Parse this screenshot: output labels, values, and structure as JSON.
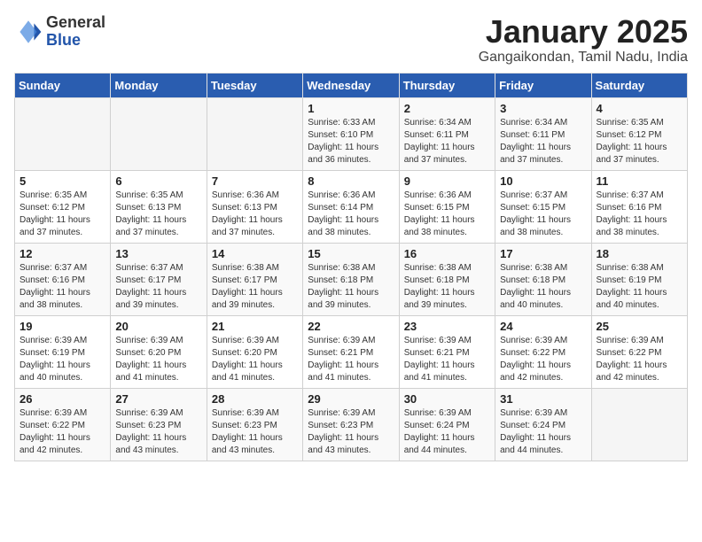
{
  "header": {
    "logo_general": "General",
    "logo_blue": "Blue",
    "month_title": "January 2025",
    "subtitle": "Gangaikondan, Tamil Nadu, India"
  },
  "weekdays": [
    "Sunday",
    "Monday",
    "Tuesday",
    "Wednesday",
    "Thursday",
    "Friday",
    "Saturday"
  ],
  "weeks": [
    [
      {
        "day": "",
        "info": ""
      },
      {
        "day": "",
        "info": ""
      },
      {
        "day": "",
        "info": ""
      },
      {
        "day": "1",
        "info": "Sunrise: 6:33 AM\nSunset: 6:10 PM\nDaylight: 11 hours and 36 minutes."
      },
      {
        "day": "2",
        "info": "Sunrise: 6:34 AM\nSunset: 6:11 PM\nDaylight: 11 hours and 37 minutes."
      },
      {
        "day": "3",
        "info": "Sunrise: 6:34 AM\nSunset: 6:11 PM\nDaylight: 11 hours and 37 minutes."
      },
      {
        "day": "4",
        "info": "Sunrise: 6:35 AM\nSunset: 6:12 PM\nDaylight: 11 hours and 37 minutes."
      }
    ],
    [
      {
        "day": "5",
        "info": "Sunrise: 6:35 AM\nSunset: 6:12 PM\nDaylight: 11 hours and 37 minutes."
      },
      {
        "day": "6",
        "info": "Sunrise: 6:35 AM\nSunset: 6:13 PM\nDaylight: 11 hours and 37 minutes."
      },
      {
        "day": "7",
        "info": "Sunrise: 6:36 AM\nSunset: 6:13 PM\nDaylight: 11 hours and 37 minutes."
      },
      {
        "day": "8",
        "info": "Sunrise: 6:36 AM\nSunset: 6:14 PM\nDaylight: 11 hours and 38 minutes."
      },
      {
        "day": "9",
        "info": "Sunrise: 6:36 AM\nSunset: 6:15 PM\nDaylight: 11 hours and 38 minutes."
      },
      {
        "day": "10",
        "info": "Sunrise: 6:37 AM\nSunset: 6:15 PM\nDaylight: 11 hours and 38 minutes."
      },
      {
        "day": "11",
        "info": "Sunrise: 6:37 AM\nSunset: 6:16 PM\nDaylight: 11 hours and 38 minutes."
      }
    ],
    [
      {
        "day": "12",
        "info": "Sunrise: 6:37 AM\nSunset: 6:16 PM\nDaylight: 11 hours and 38 minutes."
      },
      {
        "day": "13",
        "info": "Sunrise: 6:37 AM\nSunset: 6:17 PM\nDaylight: 11 hours and 39 minutes."
      },
      {
        "day": "14",
        "info": "Sunrise: 6:38 AM\nSunset: 6:17 PM\nDaylight: 11 hours and 39 minutes."
      },
      {
        "day": "15",
        "info": "Sunrise: 6:38 AM\nSunset: 6:18 PM\nDaylight: 11 hours and 39 minutes."
      },
      {
        "day": "16",
        "info": "Sunrise: 6:38 AM\nSunset: 6:18 PM\nDaylight: 11 hours and 39 minutes."
      },
      {
        "day": "17",
        "info": "Sunrise: 6:38 AM\nSunset: 6:18 PM\nDaylight: 11 hours and 40 minutes."
      },
      {
        "day": "18",
        "info": "Sunrise: 6:38 AM\nSunset: 6:19 PM\nDaylight: 11 hours and 40 minutes."
      }
    ],
    [
      {
        "day": "19",
        "info": "Sunrise: 6:39 AM\nSunset: 6:19 PM\nDaylight: 11 hours and 40 minutes."
      },
      {
        "day": "20",
        "info": "Sunrise: 6:39 AM\nSunset: 6:20 PM\nDaylight: 11 hours and 41 minutes."
      },
      {
        "day": "21",
        "info": "Sunrise: 6:39 AM\nSunset: 6:20 PM\nDaylight: 11 hours and 41 minutes."
      },
      {
        "day": "22",
        "info": "Sunrise: 6:39 AM\nSunset: 6:21 PM\nDaylight: 11 hours and 41 minutes."
      },
      {
        "day": "23",
        "info": "Sunrise: 6:39 AM\nSunset: 6:21 PM\nDaylight: 11 hours and 41 minutes."
      },
      {
        "day": "24",
        "info": "Sunrise: 6:39 AM\nSunset: 6:22 PM\nDaylight: 11 hours and 42 minutes."
      },
      {
        "day": "25",
        "info": "Sunrise: 6:39 AM\nSunset: 6:22 PM\nDaylight: 11 hours and 42 minutes."
      }
    ],
    [
      {
        "day": "26",
        "info": "Sunrise: 6:39 AM\nSunset: 6:22 PM\nDaylight: 11 hours and 42 minutes."
      },
      {
        "day": "27",
        "info": "Sunrise: 6:39 AM\nSunset: 6:23 PM\nDaylight: 11 hours and 43 minutes."
      },
      {
        "day": "28",
        "info": "Sunrise: 6:39 AM\nSunset: 6:23 PM\nDaylight: 11 hours and 43 minutes."
      },
      {
        "day": "29",
        "info": "Sunrise: 6:39 AM\nSunset: 6:23 PM\nDaylight: 11 hours and 43 minutes."
      },
      {
        "day": "30",
        "info": "Sunrise: 6:39 AM\nSunset: 6:24 PM\nDaylight: 11 hours and 44 minutes."
      },
      {
        "day": "31",
        "info": "Sunrise: 6:39 AM\nSunset: 6:24 PM\nDaylight: 11 hours and 44 minutes."
      },
      {
        "day": "",
        "info": ""
      }
    ]
  ]
}
